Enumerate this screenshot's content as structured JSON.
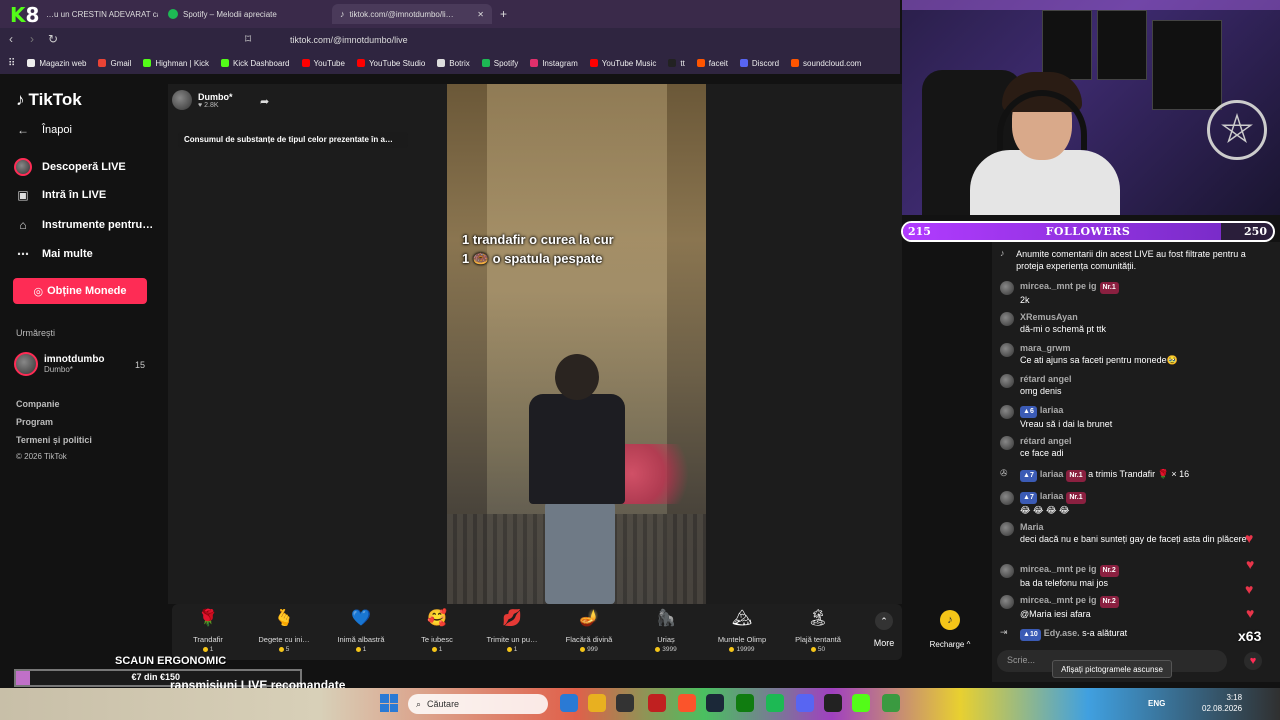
{
  "browser": {
    "tabs": [
      {
        "title": "…u un CRESTIN ADEVARAT ca…",
        "active": false
      },
      {
        "title": "Spotify – Melodii apreciate",
        "active": false
      },
      {
        "title": "tiktok.com/@imnotdumbo/li…",
        "active": true
      }
    ],
    "url": "tiktok.com/@imnotdumbo/live",
    "bookmarks": [
      "Magazin web",
      "Gmail",
      "Highman | Kick",
      "Kick Dashboard",
      "YouTube",
      "YouTube Studio",
      "Botrix",
      "Spotify",
      "Instagram",
      "YouTube Music",
      "tt",
      "faceit",
      "Discord",
      "soundcloud.com"
    ]
  },
  "sidebar": {
    "logo": "TikTok",
    "back": "Înapoi",
    "items": [
      "Descoperă LIVE",
      "Intră în LIVE",
      "Instrumente pentru…",
      "Mai multe"
    ],
    "coins_button": "Obține Monede",
    "following_header": "Urmărești",
    "following_user": {
      "name": "imnotdumbo",
      "display": "Dumbo*",
      "count": "15"
    },
    "footer": [
      "Companie",
      "Program",
      "Termeni și politici",
      "© 2026 TikTok"
    ]
  },
  "stream": {
    "host": "Dumbo*",
    "likes": "2.8K",
    "warning": "Consumul de substanțe de tipul celor prezentate în a…",
    "overlay_line1": "1 trandafir o curea la cur",
    "overlay_line2": "1 🍩 o spatula pespate"
  },
  "gifts": [
    {
      "name": "Trandafir",
      "price": "1",
      "icon": "🌹"
    },
    {
      "name": "Degete cu ini…",
      "price": "5",
      "icon": "🫰"
    },
    {
      "name": "Inimă albastră",
      "price": "1",
      "icon": "💙"
    },
    {
      "name": "Te iubesc",
      "price": "1",
      "icon": "🥰"
    },
    {
      "name": "Trimite un pu…",
      "price": "1",
      "icon": "💋"
    },
    {
      "name": "Flacără divină",
      "price": "999",
      "icon": "🪔"
    },
    {
      "name": "Uriaș",
      "price": "3999",
      "icon": "🦍"
    },
    {
      "name": "Muntele Olimp",
      "price": "19999",
      "icon": "🏔"
    },
    {
      "name": "Plajă tentantă",
      "price": "50",
      "icon": "🏝"
    }
  ],
  "gift_more": "More",
  "recharge": "Recharge ^",
  "followers_goal": {
    "label": "FOLLOWERS",
    "current": "215",
    "goal": "250",
    "progress": 0.86
  },
  "chat": [
    {
      "user": "",
      "text": "Anumite comentarii din acest LIVE au fost filtrate pentru a proteja experiența comunității.",
      "type": "system"
    },
    {
      "user": "mircea._mnt pe ig",
      "badge": "Nr.1",
      "text": "2k"
    },
    {
      "user": "XRemusAyan",
      "text": "dă-mi o schemă pt ttk"
    },
    {
      "user": "mara_grwm",
      "text": "Ce ati ajuns sa faceti pentru monede🥹"
    },
    {
      "user": "rétard angel",
      "text": "omg denis"
    },
    {
      "user": "lariaa",
      "level": "6",
      "text": "Vreau să i dai la brunet"
    },
    {
      "user": "rétard angel",
      "text": "ce face adi"
    },
    {
      "user": "lariaa",
      "level": "7",
      "badge": "Nr.1",
      "text": "a trimis Trandafir 🌹 × 16",
      "type": "gift"
    },
    {
      "user": "lariaa",
      "level": "7",
      "badge": "Nr.1",
      "text": "😂 😂 😂 😂"
    },
    {
      "user": "Maria",
      "text": "deci dacă nu e bani sunteți gay de faceți asta din plăcere"
    },
    {
      "user": "mircea._mnt pe ig",
      "badge": "Nr.2",
      "text": "ba da telefonu mai jos"
    },
    {
      "user": "mircea._mnt pe ig",
      "badge": "Nr.2",
      "text": "@Maria iesi afara"
    },
    {
      "user": "Edy.ase.",
      "level": "10",
      "text": "s-a alăturat",
      "type": "join"
    }
  ],
  "chat_input_placeholder": "Scrie...",
  "tooltip": "Afișați pictogramele ascunse",
  "like_multiplier": "x63",
  "overlay_bottom": {
    "title": "SCAUN ERGONOMIC",
    "progress_text": "€7 din €150",
    "progress": 0.05,
    "recommended": "ransmisiuni LIVE recomandate"
  },
  "taskbar": {
    "search": "Căutare",
    "lang": "ENG",
    "time": "3:18",
    "date": "02.08.2026"
  }
}
